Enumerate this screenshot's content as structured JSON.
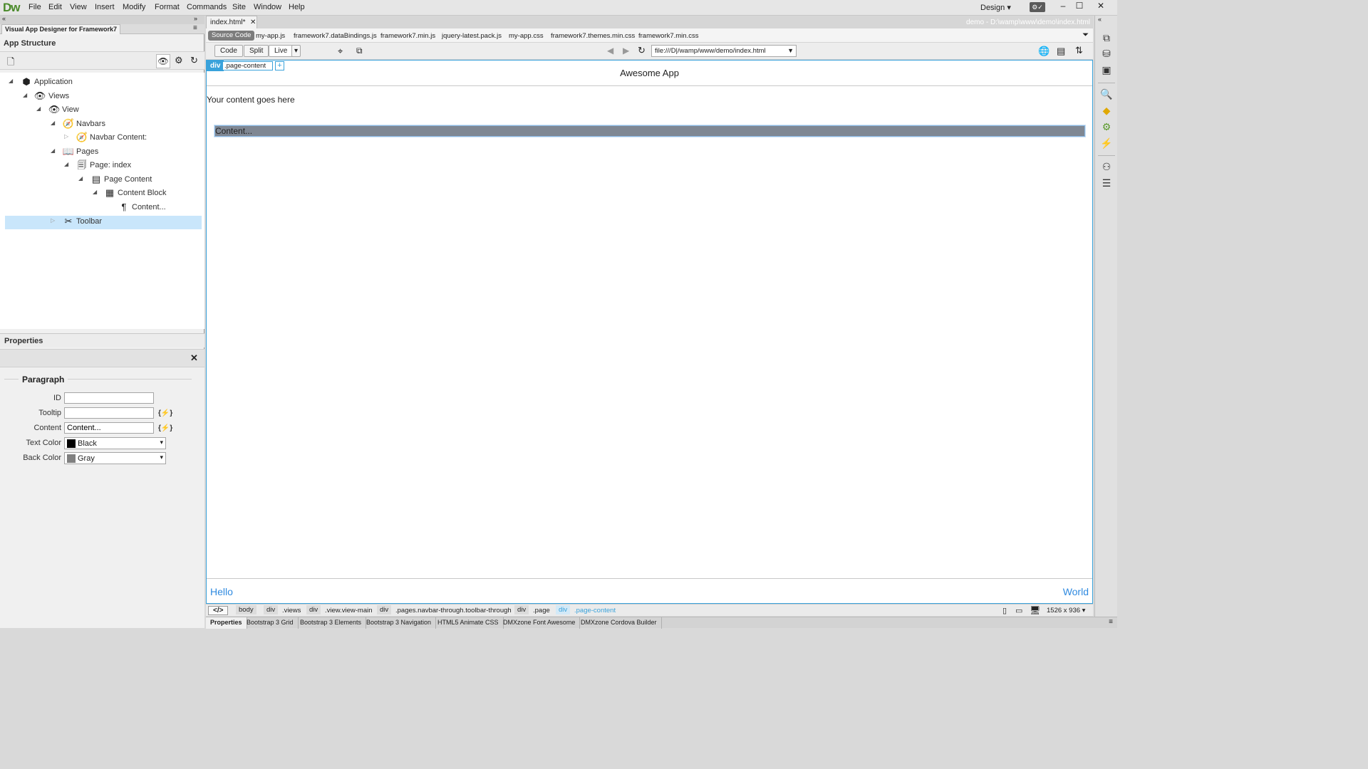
{
  "app": {
    "logo": "Dw",
    "menu": [
      "File",
      "Edit",
      "View",
      "Insert",
      "Modify",
      "Format",
      "Commands",
      "Site",
      "Window",
      "Help"
    ],
    "workspace": "Design"
  },
  "left_panel": {
    "panel_tab": "Visual App Designer for Framework7",
    "title": "App Structure",
    "tree": [
      {
        "label": "Application",
        "icon": "cube-icon"
      },
      {
        "label": "Views",
        "icon": "eye-icon"
      },
      {
        "label": "View",
        "icon": "eye-icon"
      },
      {
        "label": "Navbars",
        "icon": "compass-icon"
      },
      {
        "label": "Navbar Content:",
        "icon": "compass-icon"
      },
      {
        "label": "Pages",
        "icon": "book-icon"
      },
      {
        "label": "Page: index",
        "icon": "page-icon"
      },
      {
        "label": "Page Content",
        "icon": "page-content-icon"
      },
      {
        "label": "Content Block",
        "icon": "grid-icon"
      },
      {
        "label": "Content...",
        "icon": "paragraph-icon"
      },
      {
        "label": "Toolbar",
        "icon": "tools-icon"
      }
    ],
    "properties": {
      "title": "Properties",
      "section": "Paragraph",
      "id_label": "ID",
      "id_value": "",
      "tooltip_label": "Tooltip",
      "tooltip_value": "",
      "content_label": "Content",
      "content_value": "Content...",
      "text_color_label": "Text Color",
      "text_color_value": "Black",
      "text_color_swatch": "#000000",
      "back_color_label": "Back Color",
      "back_color_value": "Gray",
      "back_color_swatch": "#808080",
      "bind_symbol": "{⚡}"
    }
  },
  "document": {
    "tab": "index.html*",
    "path": "demo - D:\\wamp\\www\\demo\\index.html",
    "related_files": [
      "Source Code",
      "my-app.js",
      "framework7.dataBindings.js",
      "framework7.min.js",
      "jquery-latest.pack.js",
      "my-app.css",
      "framework7.themes.min.css",
      "framework7.min.css"
    ],
    "view_buttons": {
      "code": "Code",
      "split": "Split",
      "live": "Live"
    },
    "url": "file:///D|/wamp/www/demo/index.html"
  },
  "canvas": {
    "selector_tag": "div",
    "selector_class": ".page-content",
    "selector_plus": "+",
    "app_title": "Awesome App",
    "content_text": "Your content goes here",
    "content_block": "Content...",
    "toolbar_left": "Hello",
    "toolbar_right": "World"
  },
  "tag_selector": {
    "code_toggle": "</>",
    "items": [
      {
        "tag": "body",
        "cls": ""
      },
      {
        "tag": "div",
        "cls": ".views"
      },
      {
        "tag": "div",
        "cls": ".view.view-main"
      },
      {
        "tag": "div",
        "cls": ".pages.navbar-through.toolbar-through"
      },
      {
        "tag": "div",
        "cls": ".page"
      },
      {
        "tag": "div",
        "cls": ".page-content"
      }
    ],
    "size": "1526 x 936"
  },
  "bottom_tabs": [
    "Properties",
    "Bootstrap 3 Grid",
    "Bootstrap 3 Elements",
    "Bootstrap 3 Navigation",
    "HTML5 Animate CSS",
    "DMXzone Font Awesome",
    "DMXzone Cordova Builder"
  ],
  "colors": {
    "accent": "#39a2db",
    "link": "#2f8ae0",
    "selection": "#c9e6fb",
    "content_block_bg": "#7f8793"
  }
}
